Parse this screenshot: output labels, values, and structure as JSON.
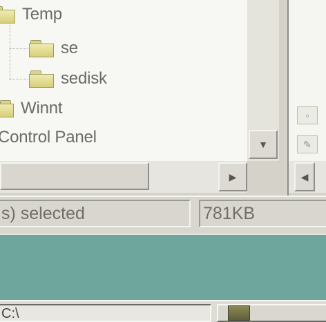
{
  "tree": {
    "items": [
      {
        "label": "Temp"
      },
      {
        "label": "se"
      },
      {
        "label": "sedisk"
      },
      {
        "label": "Winnt"
      },
      {
        "label": "Control Panel"
      }
    ]
  },
  "scrollbars": {
    "down_arrow": "▼",
    "right_arrow": "▶",
    "left_arrow": "◀"
  },
  "status_bar": {
    "selection_text": "s) selected",
    "size_text": "781KB"
  },
  "taskbar": {
    "button_text": "C:\\",
    "second_button_text": ""
  },
  "icons": {
    "folder": "folder-icon",
    "tray": "tray-icon"
  },
  "colors": {
    "desktop": "#6ea69e",
    "folder": "#e6df96",
    "window": "#d4d2c9"
  }
}
